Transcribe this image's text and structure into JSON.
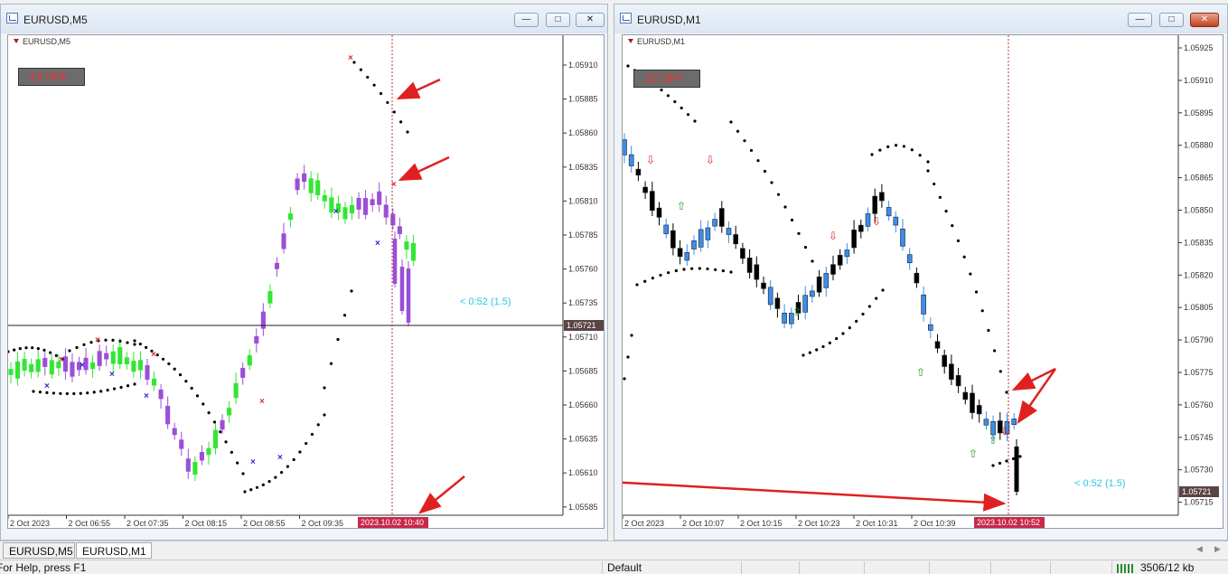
{
  "left_window": {
    "title": "EURUSD,M5",
    "symbol_label": "EURUSD,M5",
    "zz_button": "ZZ OFF",
    "countdown": "< 0:52 (1.5)",
    "current_price": "1.05721",
    "price_ticks": [
      "1.05910",
      "1.05885",
      "1.05860",
      "1.05835",
      "1.05810",
      "1.05785",
      "1.05760",
      "1.05735",
      "1.05710",
      "1.05685",
      "1.05660",
      "1.05635",
      "1.05610",
      "1.05585"
    ],
    "time_ticks": [
      "2 Oct 2023",
      "2 Oct 06:55",
      "2 Oct 07:35",
      "2 Oct 08:15",
      "2 Oct 08:55",
      "2 Oct 09:35"
    ],
    "cursor_time": "2023.10.02 10:40"
  },
  "right_window": {
    "title": "EURUSD,M1",
    "symbol_label": "EURUSD,M1",
    "zz_button": "ZZ OFF",
    "countdown": "< 0:52 (1.5)",
    "current_price": "1.05721",
    "price_ticks": [
      "1.05925",
      "1.05910",
      "1.05895",
      "1.05880",
      "1.05865",
      "1.05850",
      "1.05835",
      "1.05820",
      "1.05805",
      "1.05790",
      "1.05775",
      "1.05760",
      "1.05745",
      "1.05730",
      "1.05715"
    ],
    "time_ticks": [
      "2 Oct 2023",
      "2 Oct 10:07",
      "2 Oct 10:15",
      "2 Oct 10:23",
      "2 Oct 10:31",
      "2 Oct 10:39"
    ],
    "cursor_time": "2023.10.02 10:52"
  },
  "tabs": [
    {
      "label": "EURUSD,M5",
      "active": false
    },
    {
      "label": "EURUSD,M1",
      "active": true
    }
  ],
  "status": {
    "help": "For Help, press F1",
    "profile": "Default",
    "traffic": "3506/12 kb"
  },
  "colors": {
    "bull_left": "#33e633",
    "bear_left": "#9b4fd6",
    "bull_right": "#3b8ee8",
    "bear_right": "#000000",
    "arrow_annotation": "#e02020",
    "countdown": "#29c7e6",
    "price_label_bg": "#5a4444",
    "time_label_bg": "#c8284a"
  }
}
